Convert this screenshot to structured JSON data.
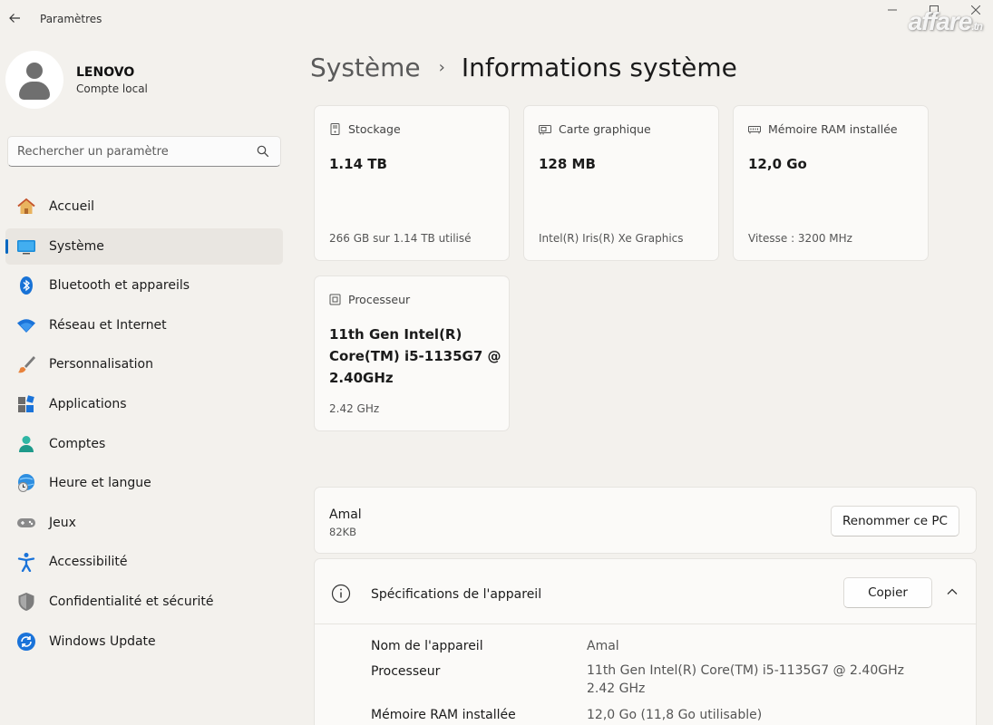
{
  "window": {
    "title": "Paramètres",
    "watermark": "affare",
    "watermark_suffix": ".tn"
  },
  "profile": {
    "name": "LENOVO",
    "account_type": "Compte local"
  },
  "search": {
    "placeholder": "Rechercher un paramètre"
  },
  "sidebar": {
    "items": [
      {
        "label": "Accueil",
        "icon": "home-icon"
      },
      {
        "label": "Système",
        "icon": "system-icon",
        "active": true
      },
      {
        "label": "Bluetooth et appareils",
        "icon": "bluetooth-icon"
      },
      {
        "label": "Réseau et Internet",
        "icon": "wifi-icon"
      },
      {
        "label": "Personnalisation",
        "icon": "brush-icon"
      },
      {
        "label": "Applications",
        "icon": "apps-icon"
      },
      {
        "label": "Comptes",
        "icon": "account-icon"
      },
      {
        "label": "Heure et langue",
        "icon": "globe-clock-icon"
      },
      {
        "label": "Jeux",
        "icon": "gamepad-icon"
      },
      {
        "label": "Accessibilité",
        "icon": "accessibility-icon"
      },
      {
        "label": "Confidentialité et sécurité",
        "icon": "shield-icon"
      },
      {
        "label": "Windows Update",
        "icon": "update-icon"
      }
    ]
  },
  "breadcrumb": {
    "parent": "Système",
    "separator": "›",
    "current": "Informations système"
  },
  "cards": {
    "storage": {
      "heading": "Stockage",
      "value": "1.14 TB",
      "detail": "266 GB sur 1.14 TB utilisé"
    },
    "gpu": {
      "heading": "Carte graphique",
      "value": "128 MB",
      "detail": "Intel(R) Iris(R) Xe Graphics"
    },
    "ram": {
      "heading": "Mémoire RAM installée",
      "value": "12,0 Go",
      "detail": "Vitesse : 3200 MHz"
    },
    "cpu": {
      "heading": "Processeur",
      "value": "11th Gen Intel(R) Core(TM) i5-1135G7 @ 2.40GHz",
      "detail": "2.42 GHz"
    }
  },
  "pc": {
    "name": "Amal",
    "size": "82KB",
    "rename_label": "Renommer ce PC"
  },
  "specs": {
    "title": "Spécifications de l'appareil",
    "copy_label": "Copier",
    "rows": [
      {
        "label": "Nom de l'appareil",
        "value": "Amal"
      },
      {
        "label": "Processeur",
        "value": "11th Gen Intel(R) Core(TM) i5-1135G7 @ 2.40GHz   2.42 GHz"
      },
      {
        "label": "Mémoire RAM installée",
        "value": "12,0 Go (11,8 Go utilisable)"
      }
    ]
  },
  "colors": {
    "accent": "#0067c0",
    "background": "#f3f1ed",
    "card": "#fbfaf8"
  }
}
